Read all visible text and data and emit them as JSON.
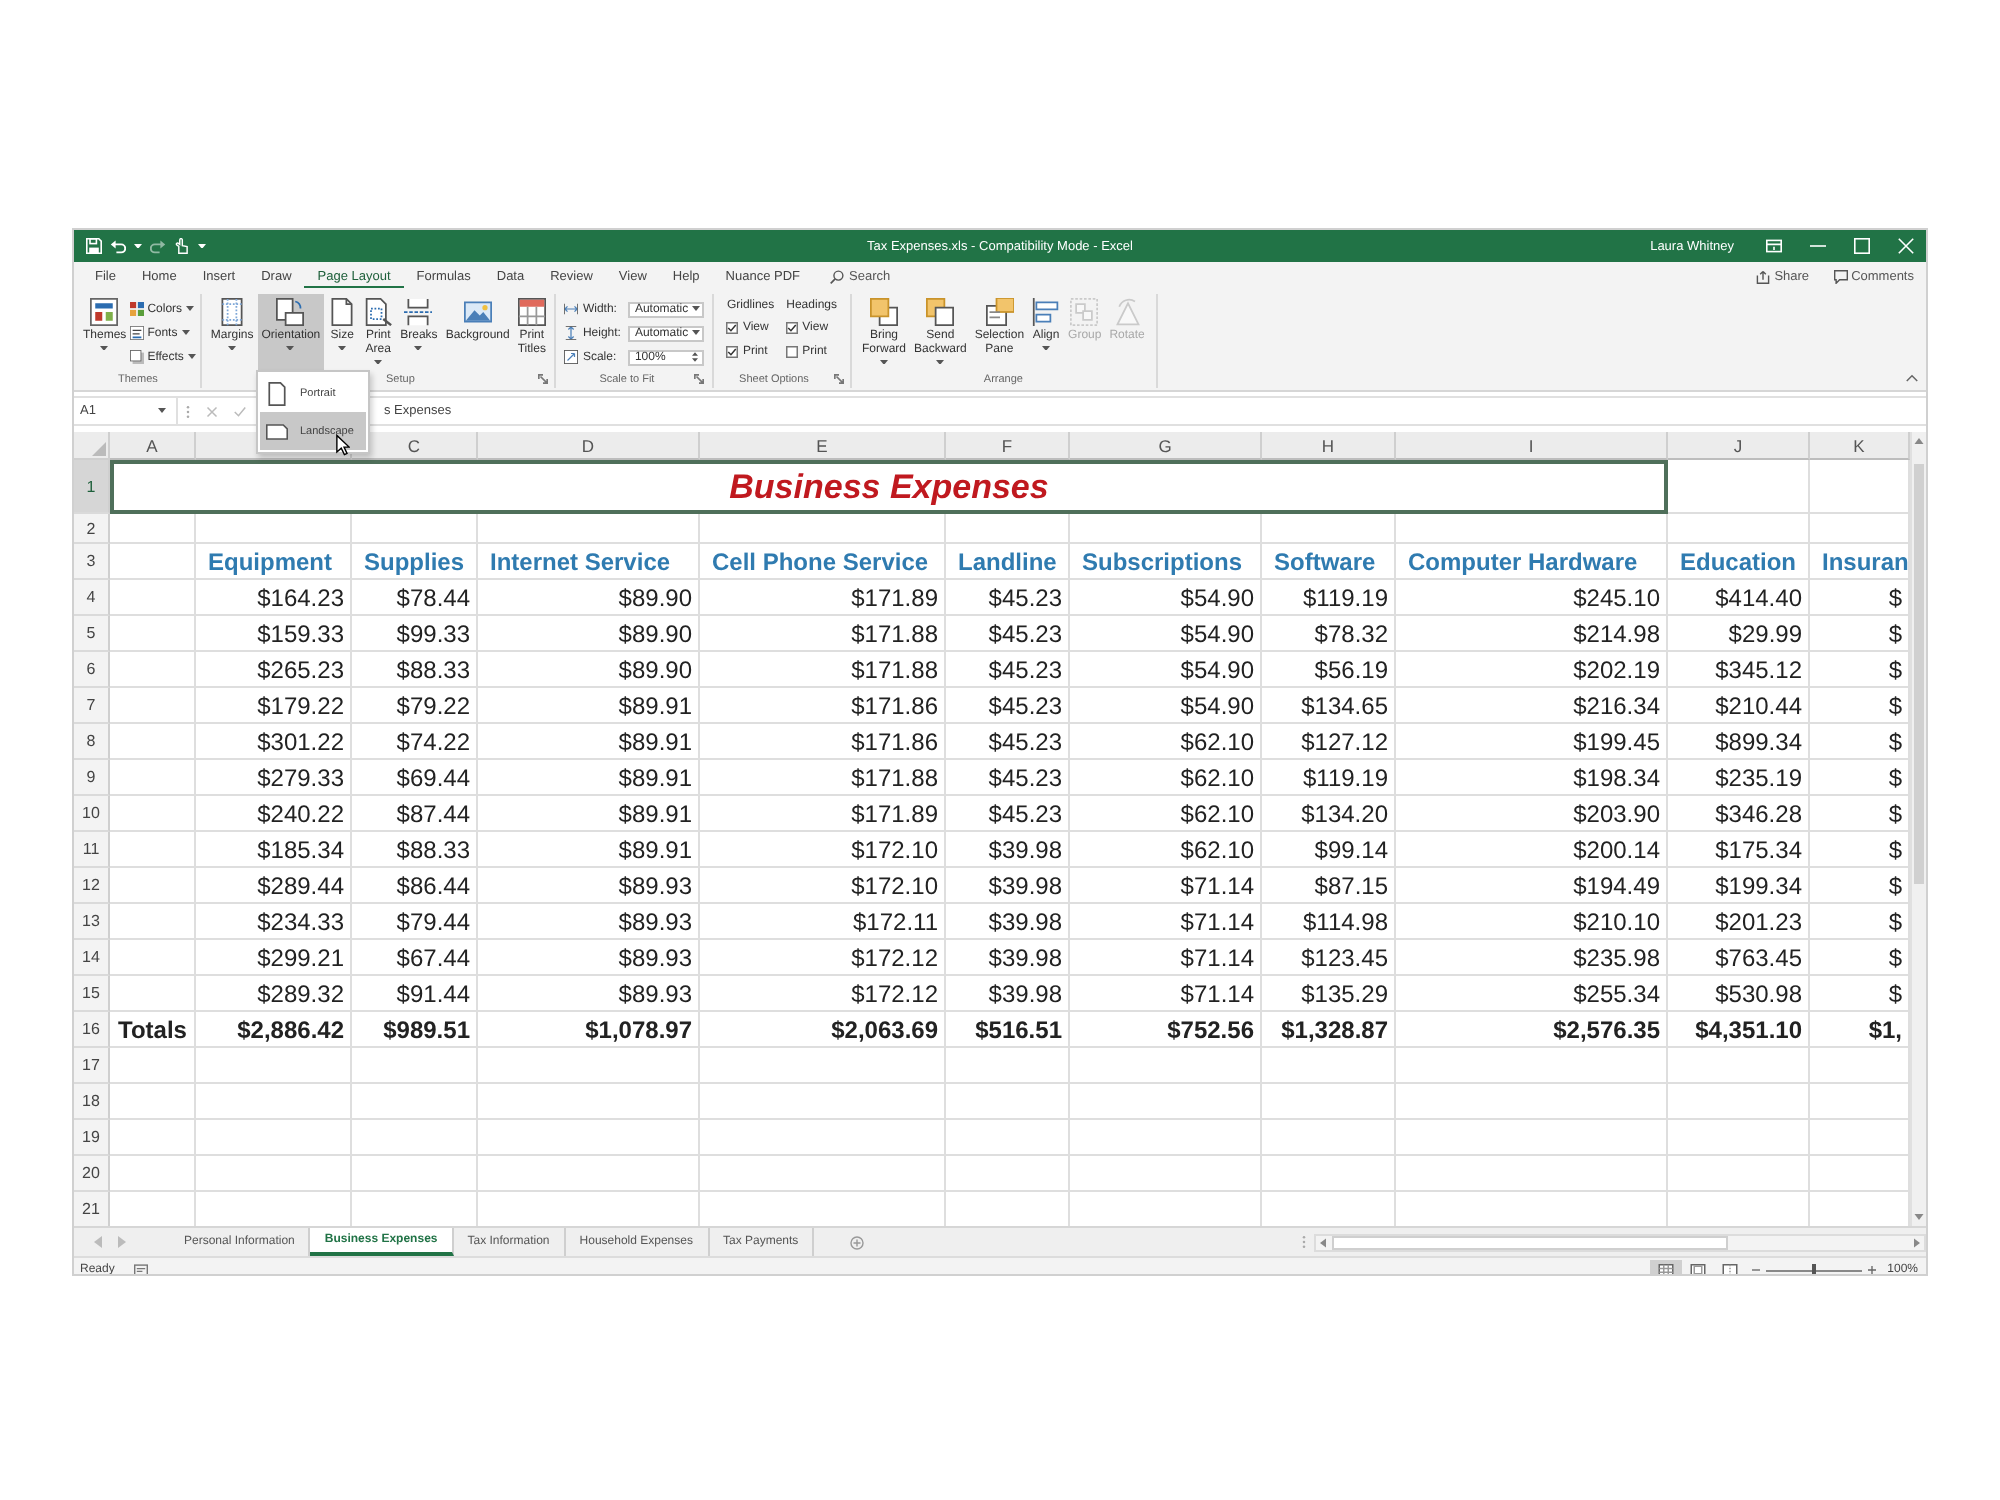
{
  "window": {
    "title": "Tax Expenses.xls - Compatibility Mode - Excel",
    "user": "Laura Whitney"
  },
  "ribbon_tabs": [
    {
      "label": "File",
      "selected": false
    },
    {
      "label": "Home",
      "selected": false
    },
    {
      "label": "Insert",
      "selected": false
    },
    {
      "label": "Draw",
      "selected": false
    },
    {
      "label": "Page Layout",
      "selected": true
    },
    {
      "label": "Formulas",
      "selected": false
    },
    {
      "label": "Data",
      "selected": false
    },
    {
      "label": "Review",
      "selected": false
    },
    {
      "label": "View",
      "selected": false
    },
    {
      "label": "Help",
      "selected": false
    },
    {
      "label": "Nuance PDF",
      "selected": false
    }
  ],
  "search": {
    "placeholder": "Search"
  },
  "share": "Share",
  "comments": "Comments",
  "ribbon_groups": [
    {
      "label": "Themes",
      "launcher": false,
      "controls": [
        {
          "kind": "large",
          "label": "Themes",
          "caret": true,
          "expanded": false,
          "disabled": false
        },
        {
          "kind": "small",
          "label": "Colors",
          "caret": true
        },
        {
          "kind": "small",
          "label": "Fonts",
          "caret": true
        },
        {
          "kind": "small",
          "label": "Effects",
          "caret": true
        }
      ]
    },
    {
      "label": "Setup",
      "launcher": true,
      "controls": [
        {
          "kind": "large",
          "label": "Margins",
          "caret": true,
          "expanded": false,
          "disabled": false
        },
        {
          "kind": "large",
          "label": "Orientation",
          "caret": true,
          "expanded": true,
          "disabled": false
        },
        {
          "kind": "large",
          "label": "Size",
          "caret": true,
          "expanded": false,
          "disabled": false
        },
        {
          "kind": "large",
          "label": "Print Area",
          "caret": true,
          "expanded": false,
          "disabled": false
        },
        {
          "kind": "large",
          "label": "Breaks",
          "caret": true,
          "expanded": false,
          "disabled": false
        },
        {
          "kind": "large",
          "label": "Background",
          "caret": false,
          "expanded": false,
          "disabled": false
        },
        {
          "kind": "large",
          "label": "Print Titles",
          "caret": false,
          "expanded": false,
          "disabled": false
        }
      ]
    },
    {
      "label": "Scale to Fit",
      "launcher": true,
      "controls": [
        {
          "kind": "field",
          "label": "Width:",
          "value": "Automatic"
        },
        {
          "kind": "field",
          "label": "Height:",
          "value": "Automatic"
        },
        {
          "kind": "spinner",
          "label": "Scale:",
          "value": "100%"
        }
      ]
    },
    {
      "label": "Sheet Options",
      "launcher": true,
      "controls": [
        {
          "kind": "checks",
          "label": "Gridlines",
          "items": [
            {
              "label": "View",
              "checked": true
            },
            {
              "label": "Print",
              "checked": true
            }
          ]
        },
        {
          "kind": "checks",
          "label": "Headings",
          "items": [
            {
              "label": "View",
              "checked": true
            },
            {
              "label": "Print",
              "checked": false
            }
          ]
        }
      ]
    },
    {
      "label": "Arrange",
      "launcher": false,
      "controls": [
        {
          "kind": "large",
          "label": "Bring Forward",
          "caret": true,
          "expanded": false,
          "disabled": false
        },
        {
          "kind": "large",
          "label": "Send Backward",
          "caret": true,
          "expanded": false,
          "disabled": false
        },
        {
          "kind": "large",
          "label": "Selection Pane",
          "caret": false,
          "expanded": false,
          "disabled": false
        },
        {
          "kind": "large",
          "label": "Align",
          "caret": true,
          "expanded": false,
          "disabled": false
        },
        {
          "kind": "large",
          "label": "Group",
          "caret": false,
          "expanded": false,
          "disabled": true
        },
        {
          "kind": "large",
          "label": "Rotate",
          "caret": false,
          "expanded": false,
          "disabled": true
        }
      ]
    }
  ],
  "formula_bar": {
    "name_box": "A1",
    "value": "s Expenses"
  },
  "orientation_menu": [
    {
      "label": "Portrait",
      "selected": false
    },
    {
      "label": "Landscape",
      "selected": true
    }
  ],
  "sheet": {
    "columns": [
      {
        "label": "A"
      },
      {},
      {
        "label": "C"
      },
      {
        "label": "D"
      },
      {
        "label": "E"
      },
      {
        "label": "F"
      },
      {
        "label": "G"
      },
      {
        "label": "H"
      },
      {
        "label": "I"
      },
      {
        "label": "J"
      },
      {
        "label": "K"
      }
    ],
    "rows": [
      {
        "number": "1",
        "kind": "title",
        "text": "Business Expenses",
        "selected": true
      },
      {
        "number": "2",
        "kind": "spacer",
        "selected": false
      },
      {
        "number": "3",
        "kind": "header",
        "selected": false,
        "cells": [
          "Equipment",
          "Supplies",
          "Internet Service",
          "Cell Phone Service",
          "Landline",
          "Subscriptions",
          "Software",
          "Computer Hardware",
          "Education",
          "Insuran"
        ]
      },
      {
        "number": "4",
        "kind": "data",
        "selected": false,
        "cells": [
          "$164.23",
          "$78.44",
          "$89.90",
          "$171.89",
          "$45.23",
          "$54.90",
          "$119.19",
          "$245.10",
          "$414.40",
          "$"
        ]
      },
      {
        "number": "5",
        "kind": "data",
        "selected": false,
        "cells": [
          "$159.33",
          "$99.33",
          "$89.90",
          "$171.88",
          "$45.23",
          "$54.90",
          "$78.32",
          "$214.98",
          "$29.99",
          "$"
        ]
      },
      {
        "number": "6",
        "kind": "data",
        "selected": false,
        "cells": [
          "$265.23",
          "$88.33",
          "$89.90",
          "$171.88",
          "$45.23",
          "$54.90",
          "$56.19",
          "$202.19",
          "$345.12",
          "$"
        ]
      },
      {
        "number": "7",
        "kind": "data",
        "selected": false,
        "cells": [
          "$179.22",
          "$79.22",
          "$89.91",
          "$171.86",
          "$45.23",
          "$54.90",
          "$134.65",
          "$216.34",
          "$210.44",
          "$"
        ]
      },
      {
        "number": "8",
        "kind": "data",
        "selected": false,
        "cells": [
          "$301.22",
          "$74.22",
          "$89.91",
          "$171.86",
          "$45.23",
          "$62.10",
          "$127.12",
          "$199.45",
          "$899.34",
          "$"
        ]
      },
      {
        "number": "9",
        "kind": "data",
        "selected": false,
        "cells": [
          "$279.33",
          "$69.44",
          "$89.91",
          "$171.88",
          "$45.23",
          "$62.10",
          "$119.19",
          "$198.34",
          "$235.19",
          "$"
        ]
      },
      {
        "number": "10",
        "kind": "data",
        "selected": false,
        "cells": [
          "$240.22",
          "$87.44",
          "$89.91",
          "$171.89",
          "$45.23",
          "$62.10",
          "$134.20",
          "$203.90",
          "$346.28",
          "$"
        ]
      },
      {
        "number": "11",
        "kind": "data",
        "selected": false,
        "cells": [
          "$185.34",
          "$88.33",
          "$89.91",
          "$172.10",
          "$39.98",
          "$62.10",
          "$99.14",
          "$200.14",
          "$175.34",
          "$"
        ]
      },
      {
        "number": "12",
        "kind": "data",
        "selected": false,
        "cells": [
          "$289.44",
          "$86.44",
          "$89.93",
          "$172.10",
          "$39.98",
          "$71.14",
          "$87.15",
          "$194.49",
          "$199.34",
          "$"
        ]
      },
      {
        "number": "13",
        "kind": "data",
        "selected": false,
        "cells": [
          "$234.33",
          "$79.44",
          "$89.93",
          "$172.11",
          "$39.98",
          "$71.14",
          "$114.98",
          "$210.10",
          "$201.23",
          "$"
        ]
      },
      {
        "number": "14",
        "kind": "data",
        "selected": false,
        "cells": [
          "$299.21",
          "$67.44",
          "$89.93",
          "$172.12",
          "$39.98",
          "$71.14",
          "$123.45",
          "$235.98",
          "$763.45",
          "$"
        ]
      },
      {
        "number": "15",
        "kind": "data",
        "selected": false,
        "cells": [
          "$289.32",
          "$91.44",
          "$89.93",
          "$172.12",
          "$39.98",
          "$71.14",
          "$135.29",
          "$255.34",
          "$530.98",
          "$"
        ]
      },
      {
        "number": "16",
        "kind": "totals",
        "selected": false,
        "label": "Totals",
        "cells": [
          "$2,886.42",
          "$989.51",
          "$1,078.97",
          "$2,063.69",
          "$516.51",
          "$752.56",
          "$1,328.87",
          "$2,576.35",
          "$4,351.10",
          "$1,"
        ]
      },
      {
        "number": "17",
        "kind": "blank",
        "selected": false
      },
      {
        "number": "18",
        "kind": "blank",
        "selected": false
      },
      {
        "number": "19",
        "kind": "blank",
        "selected": false
      },
      {
        "number": "20",
        "kind": "blank",
        "selected": false
      },
      {
        "number": "21",
        "kind": "blank",
        "selected": false
      }
    ]
  },
  "sheet_tabs": [
    {
      "label": "Personal Information",
      "selected": false
    },
    {
      "label": "Business Expenses",
      "selected": true
    },
    {
      "label": "Tax Information",
      "selected": false
    },
    {
      "label": "Household Expenses",
      "selected": false
    },
    {
      "label": "Tax Payments",
      "selected": false
    }
  ],
  "status_bar": {
    "text": "Ready",
    "views": [
      {
        "selected": true
      },
      {
        "selected": false
      },
      {
        "selected": false
      }
    ],
    "zoom": {
      "level": 0.5,
      "reading": "100%"
    }
  }
}
